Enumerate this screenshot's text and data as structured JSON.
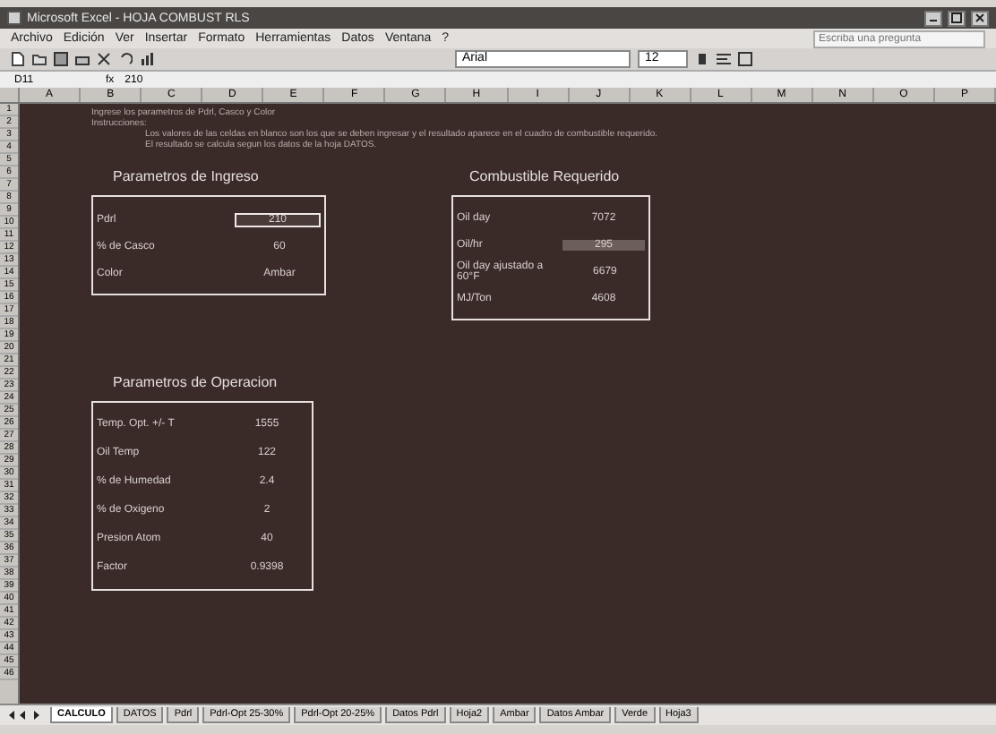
{
  "window": {
    "title": "Microsoft Excel - HOJA COMBUST RLS"
  },
  "menu": [
    "Archivo",
    "Edición",
    "Ver",
    "Insertar",
    "Formato",
    "Herramientas",
    "Datos",
    "Ventana",
    "?"
  ],
  "help": {
    "placeholder": "Escriba una pregunta"
  },
  "toolbar": {
    "font": "Arial",
    "size": "12"
  },
  "formula_bar": {
    "cell": "D11",
    "fx": "fx",
    "value": "210"
  },
  "row_headers": [
    "1",
    "2",
    "3",
    "4",
    "5",
    "6",
    "7",
    "8",
    "9",
    "10",
    "11",
    "12",
    "13",
    "14",
    "15",
    "16",
    "17",
    "18",
    "19",
    "20",
    "21",
    "22",
    "23",
    "24",
    "25",
    "26",
    "27",
    "28",
    "29",
    "30",
    "31",
    "32",
    "33",
    "34",
    "35",
    "36",
    "37",
    "38",
    "39",
    "40",
    "41",
    "42",
    "43",
    "44",
    "45",
    "46"
  ],
  "columns": [
    "A",
    "B",
    "C",
    "D",
    "E",
    "F",
    "G",
    "H",
    "I",
    "J",
    "K",
    "L",
    "M",
    "N",
    "O",
    "P"
  ],
  "instructions": [
    "Ingrese los parametros de Pdrl, Casco y Color",
    "Instrucciones:",
    "Los valores de las celdas en blanco son los que se deben ingresar y el resultado aparece en el cuadro de combustible requerido.",
    "El resultado se calcula segun los datos de la hoja DATOS."
  ],
  "input": {
    "title": "Parametros de Ingreso",
    "rows": [
      {
        "label": "Pdrl",
        "value": "210",
        "selected": true
      },
      {
        "label": "% de Casco",
        "value": "60",
        "selected": false
      },
      {
        "label": "Color",
        "value": "Ambar",
        "selected": false
      }
    ]
  },
  "fuel": {
    "title": "Combustible Requerido",
    "rows": [
      {
        "label": "Oil day",
        "value": "7072",
        "selected": false
      },
      {
        "label": "Oil/hr",
        "value": "295",
        "selected": true
      },
      {
        "label": "Oil day ajustado a 60°F",
        "value": "6679",
        "selected": false
      },
      {
        "label": "MJ/Ton",
        "value": "4608",
        "selected": false
      }
    ]
  },
  "operation": {
    "title": "Parametros de Operacion",
    "rows": [
      {
        "label": "Temp. Opt. +/- T",
        "value": "1555"
      },
      {
        "label": "Oil Temp",
        "value": "122"
      },
      {
        "label": "% de Humedad",
        "value": "2.4"
      },
      {
        "label": "% de Oxigeno",
        "value": "2"
      },
      {
        "label": "Presion Atom",
        "value": "40"
      },
      {
        "label": "Factor",
        "value": "0.9398"
      }
    ]
  },
  "sheet_tabs": [
    {
      "label": "CALCULO",
      "selected": true
    },
    {
      "label": "DATOS",
      "selected": false
    },
    {
      "label": "Pdrl",
      "selected": false
    },
    {
      "label": "Pdrl-Opt 25-30%",
      "selected": false
    },
    {
      "label": "Pdrl-Opt 20-25%",
      "selected": false
    },
    {
      "label": "Datos Pdrl",
      "selected": false
    },
    {
      "label": "Hoja2",
      "selected": false
    },
    {
      "label": "Ambar",
      "selected": false
    },
    {
      "label": "Datos Ambar",
      "selected": false
    },
    {
      "label": "Verde",
      "selected": false
    },
    {
      "label": "Hoja3",
      "selected": false
    }
  ]
}
